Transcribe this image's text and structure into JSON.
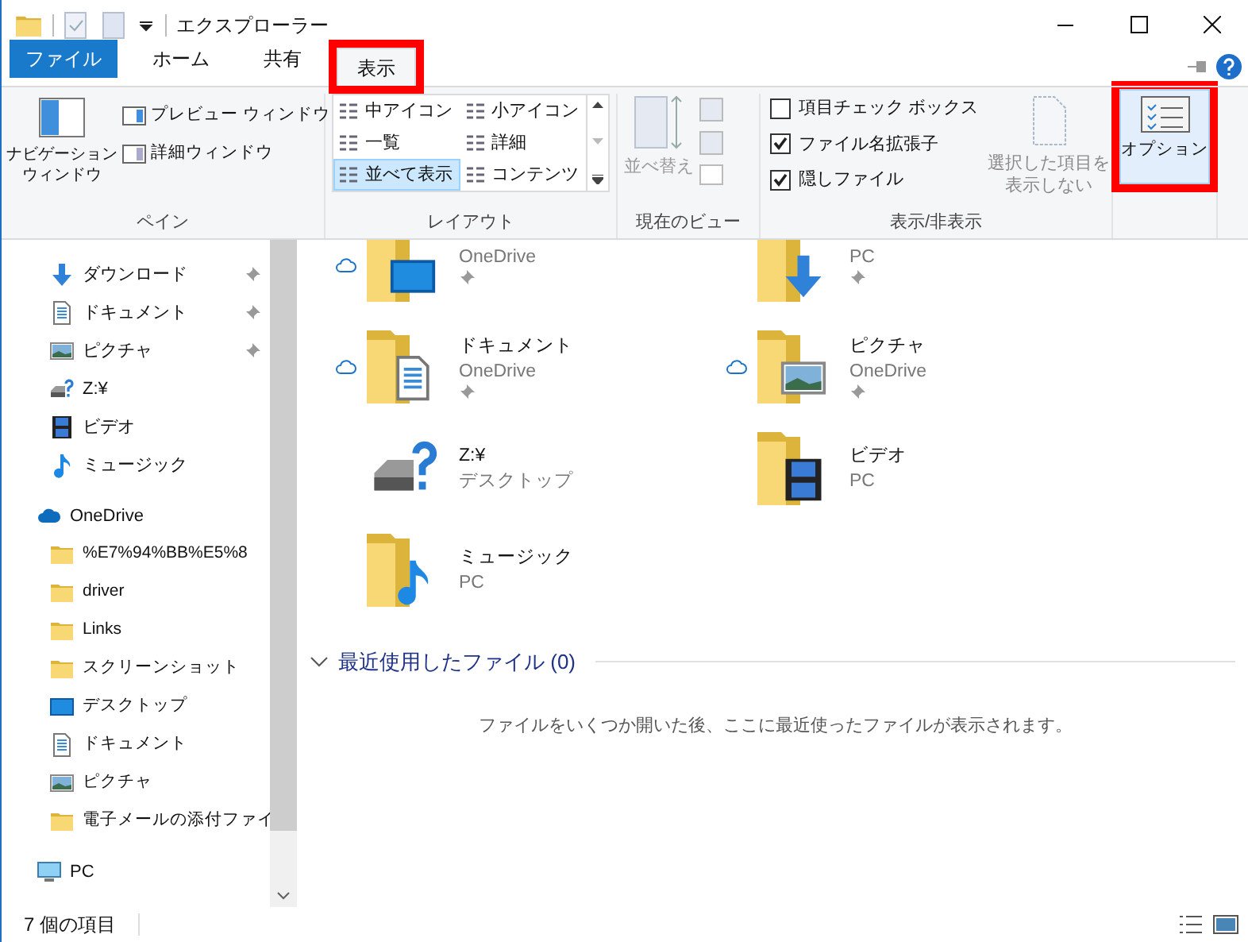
{
  "window": {
    "title": "エクスプローラー"
  },
  "tabs": [
    {
      "label": "ファイル",
      "kind": "file",
      "selected": false,
      "highlighted": false
    },
    {
      "label": "ホーム",
      "kind": "tab",
      "selected": false,
      "highlighted": false
    },
    {
      "label": "共有",
      "kind": "tab",
      "selected": false,
      "highlighted": false
    },
    {
      "label": "表示",
      "kind": "tab",
      "selected": true,
      "highlighted": true
    }
  ],
  "ribbon": {
    "pane": {
      "label": "ペイン",
      "nav_lines": [
        "ナビゲーション",
        "ウィンドウ"
      ],
      "buttons": [
        "プレビュー ウィンドウ",
        "詳細ウィンドウ"
      ]
    },
    "layout": {
      "label": "レイアウト",
      "items": [
        {
          "label": "中アイコン",
          "selected": false
        },
        {
          "label": "小アイコン",
          "selected": false
        },
        {
          "label": "一覧",
          "selected": false
        },
        {
          "label": "詳細",
          "selected": false
        },
        {
          "label": "並べて表示",
          "selected": true
        },
        {
          "label": "コンテンツ",
          "selected": false
        }
      ]
    },
    "current_view": {
      "label": "現在のビュー",
      "sort": "並べ替え",
      "disabled": true
    },
    "show_hide": {
      "label": "表示/非表示",
      "checks": [
        {
          "label": "項目チェック ボックス",
          "checked": false
        },
        {
          "label": "ファイル名拡張子",
          "checked": true
        },
        {
          "label": "隠しファイル",
          "checked": true
        }
      ],
      "hide_lines": [
        "選択した項目を",
        "表示しない"
      ],
      "hide_disabled": true
    },
    "options": {
      "label": "オプション",
      "highlighted": true
    }
  },
  "sidebar": {
    "items": [
      {
        "label": "ダウンロード",
        "kind": "download",
        "pinned": true
      },
      {
        "label": "ドキュメント",
        "kind": "document",
        "pinned": true
      },
      {
        "label": "ピクチャ",
        "kind": "picture",
        "pinned": true
      },
      {
        "label": "Z:¥",
        "kind": "drive",
        "pinned": false
      },
      {
        "label": "ビデオ",
        "kind": "video",
        "pinned": false
      },
      {
        "label": "ミュージック",
        "kind": "music",
        "pinned": false
      },
      {
        "label": "OneDrive",
        "kind": "cloud",
        "children": [
          {
            "label": "%E7%94%BB%E5%8",
            "kind": "folder"
          },
          {
            "label": "driver",
            "kind": "folder"
          },
          {
            "label": "Links",
            "kind": "folder"
          },
          {
            "label": "スクリーンショット",
            "kind": "folder"
          },
          {
            "label": "デスクトップ",
            "kind": "desktop"
          },
          {
            "label": "ドキュメント",
            "kind": "document"
          },
          {
            "label": "ピクチャ",
            "kind": "picture"
          },
          {
            "label": "電子メールの添付ファイ",
            "kind": "folder"
          }
        ]
      },
      {
        "label": "PC",
        "kind": "pc"
      }
    ]
  },
  "tiles": [
    {
      "location": "OneDrive",
      "kind": "desktop",
      "cloud": true,
      "pinned": true
    },
    {
      "location": "PC",
      "kind": "download",
      "cloud": false,
      "pinned": true
    },
    {
      "name": "ドキュメント",
      "location": "OneDrive",
      "kind": "document",
      "cloud": true,
      "pinned": true
    },
    {
      "name": "ピクチャ",
      "location": "OneDrive",
      "kind": "picture",
      "cloud": true,
      "pinned": true
    },
    {
      "name": "Z:¥",
      "location": "デスクトップ",
      "kind": "drive",
      "cloud": false,
      "pinned": false
    },
    {
      "name": "ビデオ",
      "location": "PC",
      "kind": "video",
      "cloud": false,
      "pinned": false
    },
    {
      "name": "ミュージック",
      "location": "PC",
      "kind": "music",
      "cloud": false,
      "pinned": false
    }
  ],
  "recent": {
    "title": "最近使用したファイル (0)",
    "expanded": true,
    "message": "ファイルをいくつか開いた後、ここに最近使ったファイルが表示されます。"
  },
  "status_bar": {
    "count": "7 個の項目"
  }
}
